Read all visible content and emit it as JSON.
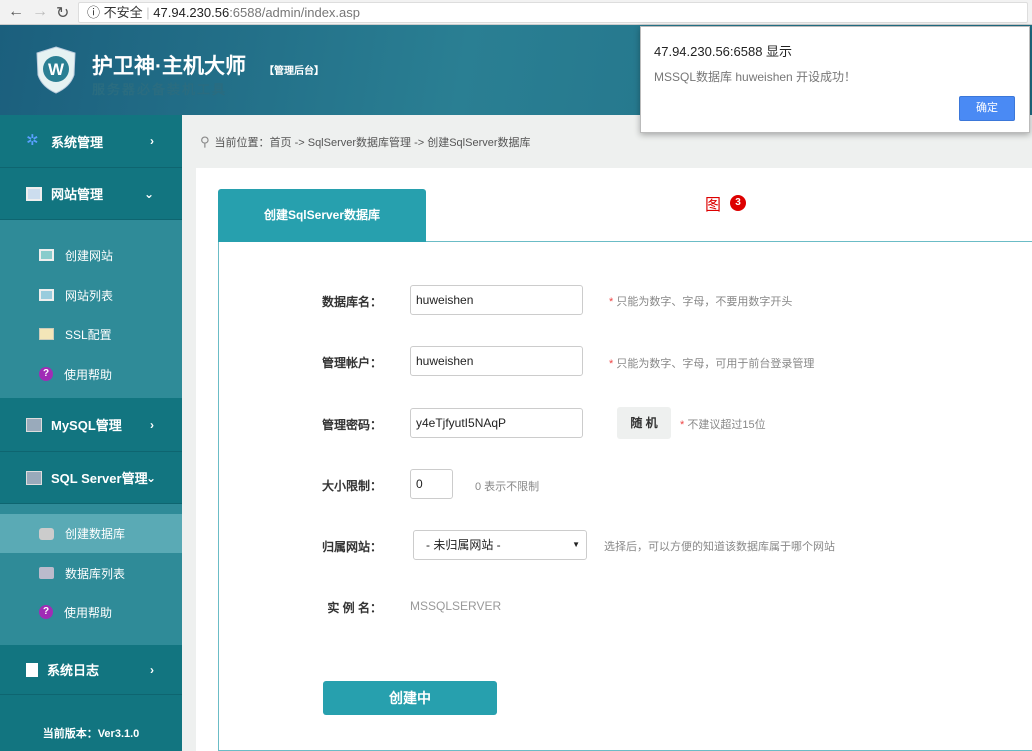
{
  "browser": {
    "security": "不安全",
    "url_host": "47.94.230.56",
    "url_rest": ":6588/admin/index.asp"
  },
  "header": {
    "title": "护卫神·主机大师",
    "tag": "【管理后台】",
    "slogan": "服务器必备装机工具",
    "logo_letter": "W"
  },
  "sidebar": {
    "sections": [
      {
        "label": "系统管理"
      },
      {
        "label": "网站管理"
      },
      {
        "label": "MySQL管理"
      },
      {
        "label": "SQL Server管理"
      },
      {
        "label": "系统日志"
      }
    ],
    "website_items": [
      {
        "label": "创建网站"
      },
      {
        "label": "网站列表"
      },
      {
        "label": "SSL配置"
      },
      {
        "label": "使用帮助"
      }
    ],
    "sqlserver_items": [
      {
        "label": "创建数据库"
      },
      {
        "label": "数据库列表"
      },
      {
        "label": "使用帮助"
      }
    ],
    "version": "当前版本：Ver3.1.0"
  },
  "breadcrumb": "当前位置：首页 -> SqlServer数据库管理 -> 创建SqlServer数据库",
  "tab": "创建SqlServer数据库",
  "annotation": {
    "char": "图",
    "num": "3"
  },
  "form": {
    "db_name": {
      "label": "数据库名：",
      "value": "huweishen",
      "hint": "只能为数字、字母，不要用数字开头"
    },
    "account": {
      "label": "管理帐户：",
      "value": "huweishen",
      "hint": "只能为数字、字母，可用于前台登录管理"
    },
    "password": {
      "label": "管理密码：",
      "value": "y4eTjfyutI5NAqP",
      "random": "随 机",
      "hint": "不建议超过15位"
    },
    "size": {
      "label": "大小限制：",
      "value": "0",
      "hint": "0 表示不限制"
    },
    "site": {
      "label": "归属网站：",
      "value": "- 未归属网站 -",
      "hint": "选择后，可以方便的知道该数据库属于哪个网站"
    },
    "instance": {
      "label": "实 例 名：",
      "value": "MSSQLSERVER"
    },
    "star": "*",
    "submit": "创建中"
  },
  "dialog": {
    "title": "47.94.230.56:6588 显示",
    "message": "MSSQL数据库 huweishen 开设成功！",
    "ok": "确定"
  }
}
